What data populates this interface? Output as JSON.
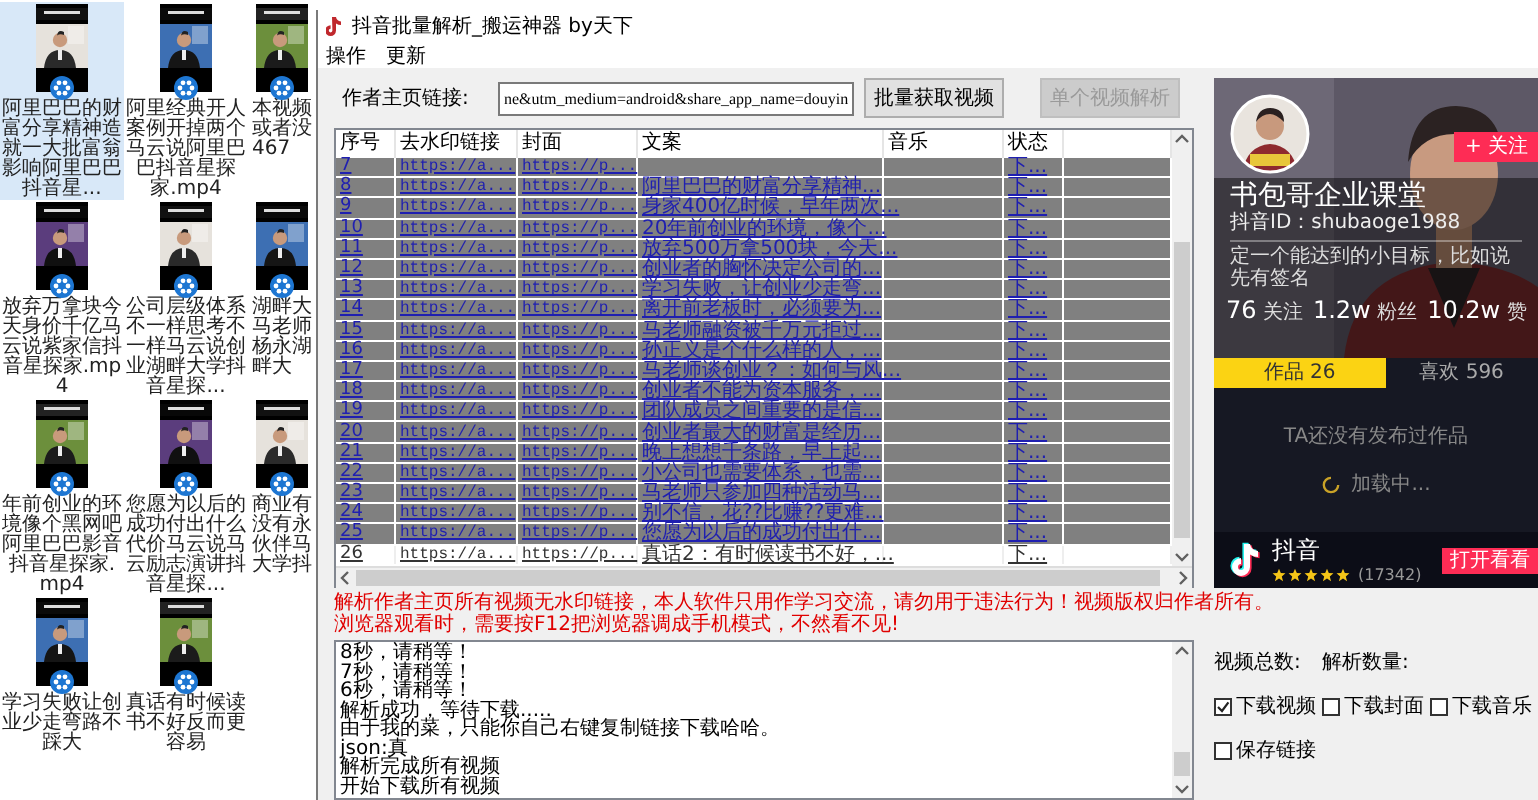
{
  "desktop": {
    "files": [
      {
        "label": "阿里巴巴的财富分享精神造就一大批富翁影响阿里巴巴抖音星...",
        "selected": true
      },
      {
        "label": "阿里经典开人案例开掉两个马云说阿里巴巴抖音星探家.mp4",
        "selected": false
      },
      {
        "label": "本视频或者没467",
        "selected": false
      },
      {
        "label": "放弃万拿块今天身价千亿马云说紫家信抖音星探家.mp4",
        "selected": false
      },
      {
        "label": "公司层级体系不一样思考不一样马云说创业湖畔大学抖音星探...",
        "selected": false
      },
      {
        "label": "湖畔大马老师杨永湖畔大",
        "selected": false
      },
      {
        "label": "年前创业的环境像个黑网吧阿里巴巴影音抖音星探家.mp4",
        "selected": false
      },
      {
        "label": "您愿为以后的成功付出什么代价马云说马云励志演讲抖音星探...",
        "selected": false
      },
      {
        "label": "商业有没有永伙伴马大学抖",
        "selected": false
      },
      {
        "label": "学习失败让创业少走弯路不踩大",
        "selected": false
      },
      {
        "label": "真话有时候读书不好反而更容易",
        "selected": false
      }
    ]
  },
  "window": {
    "title": "抖音批量解析_搬运神器 by天下",
    "menu": [
      "操作",
      "更新"
    ]
  },
  "author_link": {
    "label": "作者主页链接:",
    "value": "ne&utm_medium=android&share_app_name=douyin"
  },
  "buttons": [
    {
      "label": "批量获取视频",
      "disabled": false
    },
    {
      "label": "单个视频解析",
      "disabled": true
    }
  ],
  "table": {
    "columns": [
      "序号",
      "去水印链接",
      "封面",
      "文案",
      "音乐",
      "状态"
    ],
    "rows": [
      {
        "index": "7",
        "link": "https://a...",
        "cover": "https://p...",
        "status": "下...",
        "selected": true
      },
      {
        "index": "8",
        "link": "https://a...",
        "cover": "https://p...",
        "caption": "阿里巴巴的财富分享精神...",
        "status": "下...",
        "selected": true
      },
      {
        "index": "9",
        "link": "https://a...",
        "cover": "https://p...",
        "caption": "身家400亿时候，早年两次...",
        "status": "下...",
        "selected": true
      },
      {
        "index": "10",
        "link": "https://a...",
        "cover": "https://p...",
        "caption": "20年前创业的环境，像个...",
        "status": "下...",
        "selected": true
      },
      {
        "index": "11",
        "link": "https://a...",
        "cover": "https://p...",
        "caption": "放弃500万拿500块，今天...",
        "status": "下...",
        "selected": true
      },
      {
        "index": "12",
        "link": "https://a...",
        "cover": "https://p...",
        "caption": "创业者的胸怀决定公司的...",
        "status": "下...",
        "selected": true
      },
      {
        "index": "13",
        "link": "https://a...",
        "cover": "https://p...",
        "caption": "学习失败，让创业少走弯...",
        "status": "下...",
        "selected": true
      },
      {
        "index": "14",
        "link": "https://a...",
        "cover": "https://p...",
        "caption": "离开前老板时，必须要为...",
        "status": "下...",
        "selected": true
      },
      {
        "index": "15",
        "link": "https://a...",
        "cover": "https://p...",
        "caption": "马老师融资被千万元拒过...",
        "status": "下...",
        "selected": true
      },
      {
        "index": "16",
        "link": "https://a...",
        "cover": "https://p...",
        "caption": "孙正义是个什么样的人，...",
        "status": "下...",
        "selected": true
      },
      {
        "index": "17",
        "link": "https://a...",
        "cover": "https://p...",
        "caption": "马老师谈创业？：如何与风...",
        "status": "下...",
        "selected": true
      },
      {
        "index": "18",
        "link": "https://a...",
        "cover": "https://p...",
        "caption": "创业者不能为资本服务，...",
        "status": "下...",
        "selected": true
      },
      {
        "index": "19",
        "link": "https://a...",
        "cover": "https://p...",
        "caption": "团队成员之间重要的是信...",
        "status": "下...",
        "selected": true
      },
      {
        "index": "20",
        "link": "https://a...",
        "cover": "https://p...",
        "caption": "创业者最大的财富是经历...",
        "status": "下...",
        "selected": true
      },
      {
        "index": "21",
        "link": "https://a...",
        "cover": "https://p...",
        "caption": "晚上想想千条路，早上起...",
        "status": "下...",
        "selected": true
      },
      {
        "index": "22",
        "link": "https://a...",
        "cover": "https://p...",
        "caption": "小公司也需要体系，也需...",
        "status": "下...",
        "selected": true
      },
      {
        "index": "23",
        "link": "https://a...",
        "cover": "https://p...",
        "caption": "马老师只参加四种活动马...",
        "status": "下...",
        "selected": true
      },
      {
        "index": "24",
        "link": "https://a...",
        "cover": "https://p...",
        "caption": "别不信，花??比赚??更难...",
        "status": "下...",
        "selected": true
      },
      {
        "index": "25",
        "link": "https://a...",
        "cover": "https://p...",
        "caption": "您愿为以后的成功付出什...",
        "status": "下...",
        "selected": true
      },
      {
        "index": "26",
        "link": "https://a...",
        "cover": "https://p...",
        "caption": "真话2：有时候读书不好，...",
        "status": "下...",
        "selected": false
      }
    ]
  },
  "notice": [
    "解析作者主页所有视频无水印链接，本人软件只用作学习交流，请勿用于违法行为！视频版权归作者所有。",
    "浏览器观看时，需要按F12把浏览器调成手机模式，不然看不见!"
  ],
  "log": [
    "8秒，请稍等！",
    "7秒，请稍等！",
    "6秒，请稍等！",
    "解析成功，等待下载.....",
    "由于我的菜，只能你自己右键复制链接下载哈哈。",
    "json:真",
    "解析完成所有视频",
    "开始下载所有视频"
  ],
  "profile": {
    "follow_button": "+ 关注",
    "name": "书包哥企业课堂",
    "account_id": "抖音ID：shubaoge1988",
    "signature": "定一个能达到的小目标，比如说先有签名",
    "counts": [
      {
        "value": "76",
        "unit": "关注"
      },
      {
        "value": "1.2w",
        "unit": "粉丝"
      },
      {
        "value": "10.2w",
        "unit": "赞"
      }
    ],
    "tabs": [
      {
        "label": "作品 26",
        "selected": true
      },
      {
        "label": "喜欢 596",
        "selected": false
      }
    ],
    "empty_text": "TA还没有发布过作品",
    "loading": "加载中...",
    "app": {
      "name": "抖音",
      "stars": 5,
      "rating_count": "(17342)",
      "open_button": "打开看看"
    }
  },
  "counters": [
    "视频总数:",
    "解析数量:"
  ],
  "options": [
    {
      "label": "下载视频",
      "checked": true
    },
    {
      "label": "下载封面",
      "checked": false
    },
    {
      "label": "下载音乐",
      "checked": false
    },
    {
      "label": "保存链接",
      "checked": false
    }
  ]
}
